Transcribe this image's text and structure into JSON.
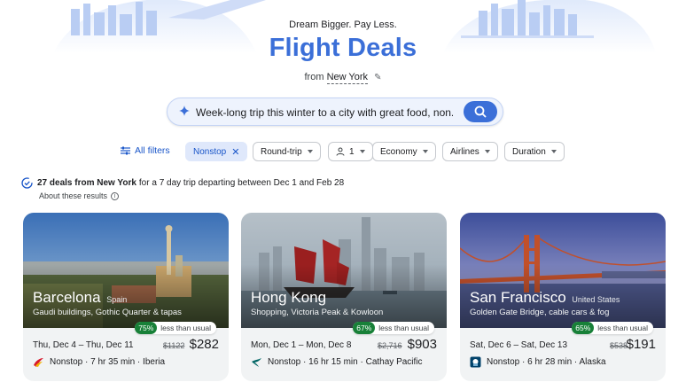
{
  "header": {
    "tagline": "Dream Bigger. Pay Less.",
    "title": "Flight Deals",
    "from_prefix": "from",
    "origin": "New York"
  },
  "search": {
    "query": "Week-long trip this winter to a city with great food, non. ."
  },
  "filters": {
    "all_filters": "All filters",
    "nonstop": "Nonstop",
    "trip_type": "Round-trip",
    "passengers": "1",
    "cabin": "Economy",
    "airlines": "Airlines",
    "duration": "Duration"
  },
  "summary": {
    "count_text": "27 deals from New York",
    "rest_text": "for a 7 day trip departing between Dec 1 and Feb 28",
    "about": "About these results"
  },
  "deals": [
    {
      "city": "Barcelona",
      "country": "Spain",
      "description": "Gaudi buildings, Gothic Quarter & tapas",
      "discount": "75%",
      "discount_label": "less than usual",
      "dates": "Thu, Dec 4 – Thu, Dec 11",
      "old_price": "$1122",
      "price": "$282",
      "flight": "Nonstop · 7 hr 35 min · Iberia",
      "airline_icon": "iberia-logo-icon",
      "accent": "#d7192d"
    },
    {
      "city": "Hong Kong",
      "country": "",
      "description": "Shopping, Victoria Peak & Kowloon",
      "discount": "67%",
      "discount_label": "less than usual",
      "dates": "Mon, Dec 1 – Mon, Dec 8",
      "old_price": "$2,716",
      "price": "$903",
      "flight": "Nonstop · 16 hr 15 min · Cathay Pacific",
      "airline_icon": "cathay-logo-icon",
      "accent": "#006564"
    },
    {
      "city": "San Francisco",
      "country": "United States",
      "description": "Golden Gate Bridge, cable cars & fog",
      "discount": "65%",
      "discount_label": "less than usual",
      "dates": "Sat, Dec 6 – Sat, Dec 13",
      "old_price": "$538",
      "price": "$191",
      "flight": "Nonstop · 6 hr 28 min · Alaska",
      "airline_icon": "alaska-logo-icon",
      "accent": "#01426a"
    }
  ],
  "colors": {
    "brand_blue": "#3b6fd8",
    "chip_active_bg": "#dfe8fb",
    "discount_green": "#188038"
  }
}
